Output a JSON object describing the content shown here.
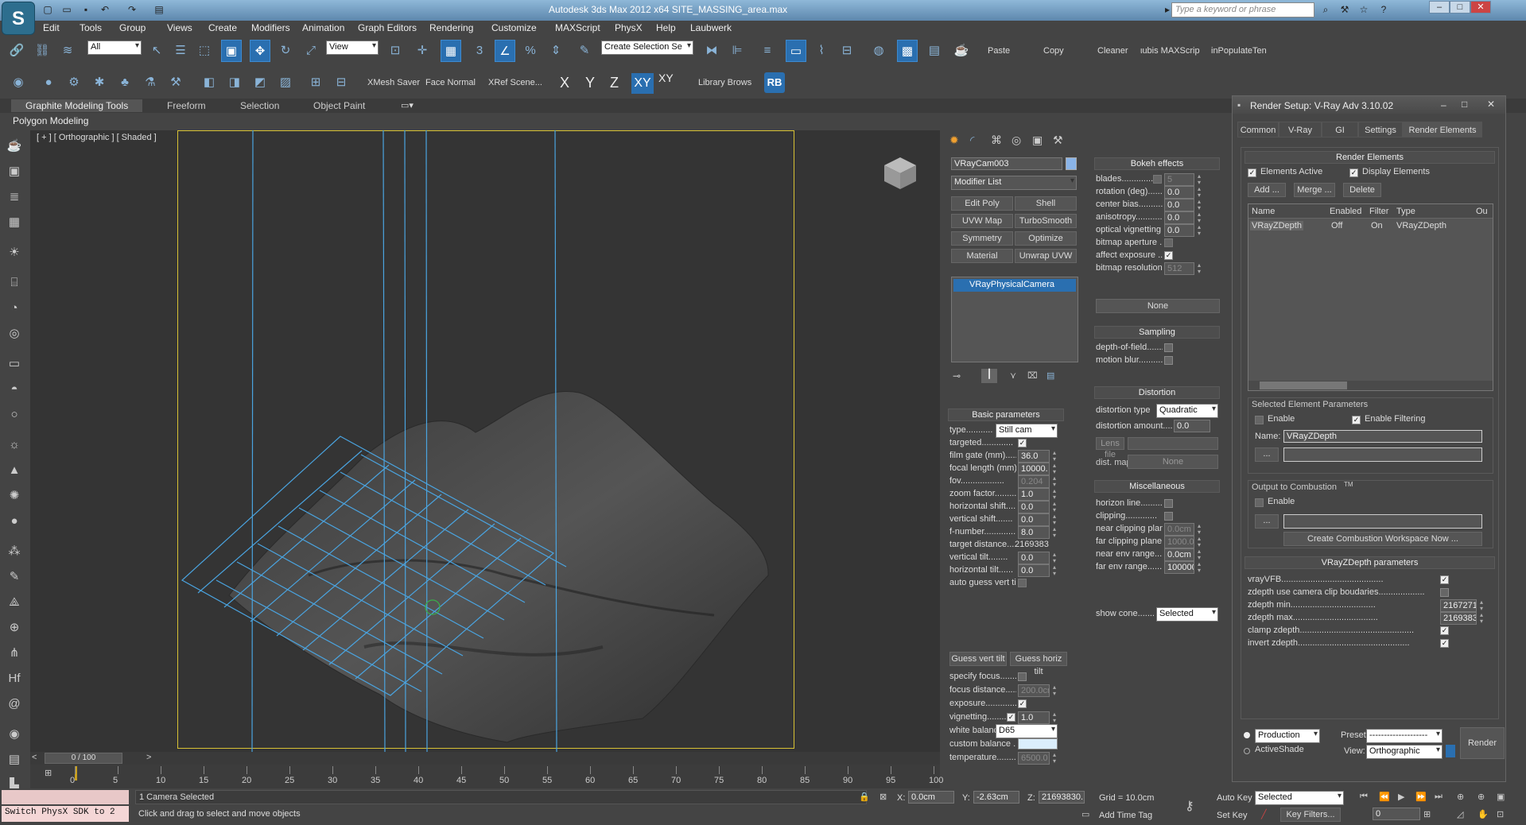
{
  "window": {
    "title": "Autodesk 3ds Max  2012 x64      SITE_MASSING_area.max"
  },
  "search": {
    "placeholder": "Type a keyword or phrase"
  },
  "menu": [
    "Edit",
    "Tools",
    "Group",
    "Views",
    "Create",
    "Modifiers",
    "Animation",
    "Graph Editors",
    "Rendering",
    "Customize",
    "MAXScript",
    "PhysX",
    "Help",
    "Laubwerk"
  ],
  "toolbar1": {
    "selection_filter": "All",
    "ref_coord": "View",
    "named_selection": "Create Selection Se",
    "paste": "Paste",
    "copy": "Copy",
    "cleaner": "Cleaner",
    "maxscript": "ιubis MAXScrip",
    "populate": "inPopulateTen"
  },
  "toolbar2": {
    "xmesh": "XMesh Saver",
    "face_normal": "Face Normal",
    "xref": "XRef Scene...",
    "axis_x": "X",
    "axis_y": "Y",
    "axis_z": "Z",
    "axis_xy": "XY",
    "axis_xy2": "XY",
    "library": "Library Brows",
    "rb": "RB"
  },
  "ribbon": {
    "tabs": [
      "Graphite Modeling Tools",
      "Freeform",
      "Selection",
      "Object Paint"
    ],
    "sub": "Polygon Modeling"
  },
  "viewport": {
    "label": "[ + ] [ Orthographic ] [ Shaded ]"
  },
  "command_panel": {
    "object_name": "VRayCam003",
    "modifier_list": "Modifier List",
    "buttons": [
      "Edit Poly",
      "Shell",
      "UVW Map",
      "TurboSmooth",
      "Symmetry",
      "Optimize",
      "Material",
      "Unwrap UVW"
    ],
    "stack_item": "VRayPhysicalCamera",
    "basic_header": "Basic parameters",
    "params": [
      {
        "label": "type...........",
        "value": "Still cam",
        "kind": "dropdown"
      },
      {
        "label": "targeted.............",
        "value": "",
        "kind": "check_on"
      },
      {
        "label": "film gate (mm).......",
        "value": "36.0",
        "kind": "spin"
      },
      {
        "label": "focal length (mm)....",
        "value": "10000.",
        "kind": "spin"
      },
      {
        "label": "fov..................",
        "value": "0.204",
        "kind": "spin_dim"
      },
      {
        "label": "zoom factor..........",
        "value": "1.0",
        "kind": "spin"
      },
      {
        "label": "horizontal shift.....",
        "value": "0.0",
        "kind": "spin"
      },
      {
        "label": "vertical shift.......",
        "value": "0.0",
        "kind": "spin"
      },
      {
        "label": "f-number.............",
        "value": "8.0",
        "kind": "spin"
      },
      {
        "label": "target distance.......",
        "value": "2169383",
        "kind": "text"
      },
      {
        "label": "vertical tilt........",
        "value": "0.0",
        "kind": "spin"
      },
      {
        "label": "horizontal tilt......",
        "value": "0.0",
        "kind": "spin"
      },
      {
        "label": "auto guess vert tilt.",
        "value": "",
        "kind": "check_dim"
      }
    ],
    "guess_vert": "Guess vert tilt",
    "guess_horiz": "Guess horiz tilt",
    "params2": [
      {
        "label": "specify focus........",
        "value": "",
        "kind": "check_off"
      },
      {
        "label": "focus distance......",
        "value": "200.0cr",
        "kind": "spin_dim"
      },
      {
        "label": "exposure.............",
        "value": "",
        "kind": "check_on"
      },
      {
        "label": "vignetting.........",
        "value": "1.0",
        "kind": "check_spin"
      },
      {
        "label": "white balance",
        "value": "D65",
        "kind": "dropdown"
      },
      {
        "label": "custom balance ......",
        "value": "",
        "kind": "swatch"
      },
      {
        "label": "temperature..........",
        "value": "6500.0",
        "kind": "spin_dim"
      }
    ]
  },
  "panel2": {
    "bokeh_header": "Bokeh effects",
    "bokeh": [
      {
        "label": "blades...............",
        "value": "5",
        "kind": "check_spin_dim"
      },
      {
        "label": "rotation (deg).......",
        "value": "0.0",
        "kind": "spin"
      },
      {
        "label": "center bias..........",
        "value": "0.0",
        "kind": "spin"
      },
      {
        "label": "anisotropy...........",
        "value": "0.0",
        "kind": "spin"
      },
      {
        "label": "optical vignetting ..",
        "value": "0.0",
        "kind": "spin"
      },
      {
        "label": "bitmap aperture ....",
        "value": "",
        "kind": "check_dim"
      },
      {
        "label": "affect exposure ....",
        "value": "",
        "kind": "check_on"
      },
      {
        "label": "bitmap resolution....",
        "value": "512",
        "kind": "spin_dim"
      }
    ],
    "none1": "None",
    "sampling_header": "Sampling",
    "sampling": [
      {
        "label": "depth-of-field.......",
        "value": "",
        "kind": "check_off"
      },
      {
        "label": "motion blur..........",
        "value": "",
        "kind": "check_off"
      }
    ],
    "distortion_header": "Distortion",
    "distortion_type_label": "distortion type",
    "distortion_type": "Quadratic",
    "distortion_amount_label": "distortion amount....",
    "distortion_amount": "0.0",
    "lens_file": "Lens file",
    "dist_map": "dist. map",
    "none2": "None",
    "misc_header": "Miscellaneous",
    "misc": [
      {
        "label": "horizon line.........",
        "value": "",
        "kind": "check_off"
      },
      {
        "label": "clipping.............",
        "value": "",
        "kind": "check_off"
      },
      {
        "label": "near clipping plane..",
        "value": "0.0cm",
        "kind": "spin_dim"
      },
      {
        "label": "far clipping plane...",
        "value": "1000.0",
        "kind": "spin_dim"
      },
      {
        "label": "near env range.......",
        "value": "0.0cm",
        "kind": "spin"
      },
      {
        "label": "far env range........",
        "value": "100000",
        "kind": "spin"
      }
    ],
    "show_cone_label": "show cone.......",
    "show_cone": "Selected"
  },
  "render_setup": {
    "title": "Render Setup: V-Ray Adv 3.10.02",
    "tabs": [
      "Common",
      "V-Ray",
      "GI",
      "Settings",
      "Render Elements"
    ],
    "elements_header": "Render Elements",
    "elements_active": "Elements Active",
    "display_elements": "Display Elements",
    "add": "Add ...",
    "merge": "Merge ...",
    "delete": "Delete",
    "table_headers": [
      "Name",
      "Enabled",
      "Filter",
      "Type",
      "Ou"
    ],
    "table_rows": [
      [
        "VRayZDepth",
        "Off",
        "On",
        "VRayZDepth"
      ]
    ],
    "selected_params": "Selected Element Parameters",
    "enable": "Enable",
    "enable_filtering": "Enable Filtering",
    "name_label": "Name:",
    "name_value": "VRayZDepth",
    "dots": "...",
    "combustion_label": "Output to Combustion",
    "tm": "TM",
    "combustion_enable": "Enable",
    "combustion_create": "Create Combustion Workspace Now ...",
    "zdepth_header": "VRayZDepth parameters",
    "zdepth": [
      {
        "label": "vrayVFB..........................................",
        "value": "",
        "kind": "check_on"
      },
      {
        "label": "zdepth use camera clip boudaries...................",
        "value": "",
        "kind": "check_off"
      },
      {
        "label": "zdepth min...................................",
        "value": "21672710.",
        "kind": "spin"
      },
      {
        "label": "zdepth max...................................",
        "value": "21693830.",
        "kind": "spin"
      },
      {
        "label": "clamp zdepth...............................................",
        "value": "",
        "kind": "check_on"
      },
      {
        "label": "invert zdepth..............................................",
        "value": "",
        "kind": "check_on"
      }
    ],
    "production": "Production",
    "activeshade": "ActiveShade",
    "preset_label": "Preset:",
    "preset_value": "--------------------",
    "view_label": "View:",
    "view_value": "Orthographic",
    "render": "Render"
  },
  "timeline": {
    "frame": "0 / 100",
    "ticks": [
      "0",
      "5",
      "10",
      "15",
      "20",
      "25",
      "30",
      "35",
      "40",
      "45",
      "50",
      "55",
      "60",
      "65",
      "70",
      "75",
      "80",
      "85",
      "90",
      "95",
      "100"
    ]
  },
  "status": {
    "maxscript_line": "Switch PhysX SDK to 2",
    "selected": "1 Camera Selected",
    "prompt": "Click and drag to select and move objects",
    "x_label": "X:",
    "x_value": "0.0cm",
    "y_label": "Y:",
    "y_value": "-2.63cm",
    "z_label": "Z:",
    "z_value": "21693830.",
    "grid": "Grid = 10.0cm",
    "add_time_tag": "Add Time Tag",
    "auto_key": "Auto Key",
    "set_key": "Set Key",
    "selected_dd": "Selected",
    "key_filters": "Key Filters...",
    "frame_value": "0"
  }
}
